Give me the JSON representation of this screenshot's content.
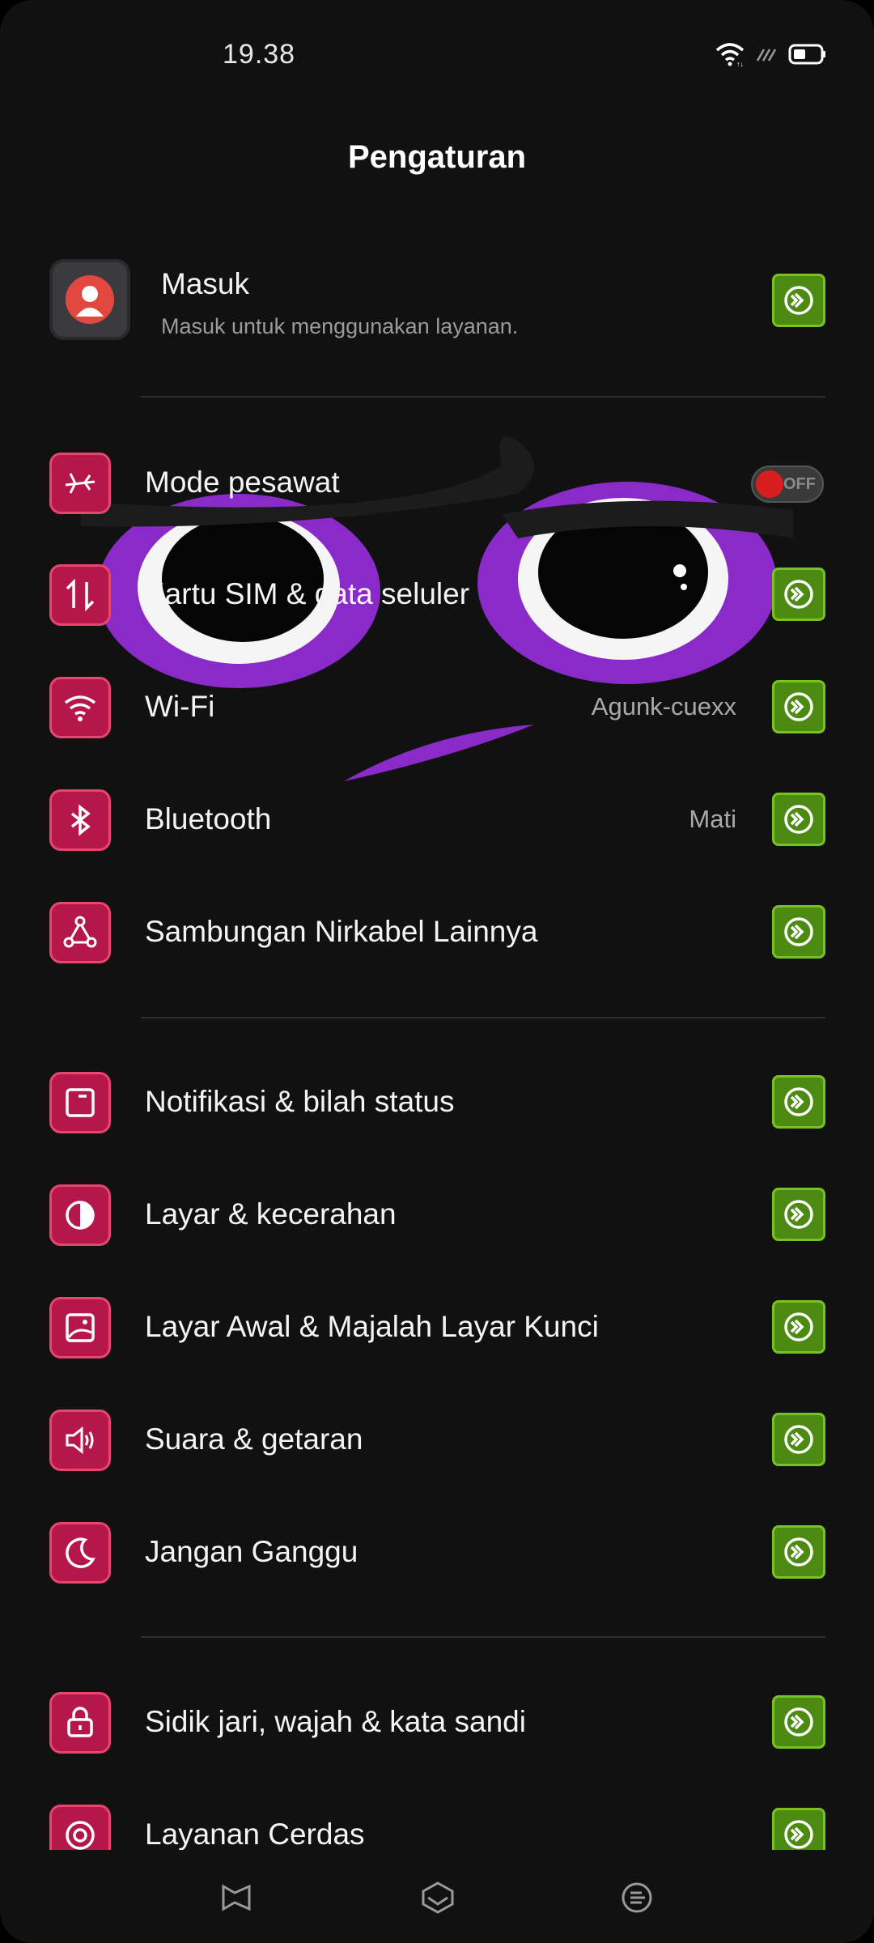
{
  "status_bar": {
    "time": "19.38"
  },
  "page_title": "Pengaturan",
  "account": {
    "title": "Masuk",
    "subtitle": "Masuk untuk menggunakan layanan."
  },
  "rows": {
    "airplane": {
      "label": "Mode pesawat",
      "toggle_text": "OFF"
    },
    "sim": {
      "label": "Kartu SIM & data seluler"
    },
    "wifi": {
      "label": "Wi-Fi",
      "value": "Agunk-cuexx"
    },
    "bluetooth": {
      "label": "Bluetooth",
      "value": "Mati"
    },
    "wireless": {
      "label": "Sambungan Nirkabel Lainnya"
    },
    "notifications": {
      "label": "Notifikasi & bilah status"
    },
    "display": {
      "label": "Layar & kecerahan"
    },
    "homescreen": {
      "label": "Layar Awal & Majalah Layar Kunci"
    },
    "sound": {
      "label": "Suara & getaran"
    },
    "dnd": {
      "label": "Jangan Ganggu"
    },
    "security": {
      "label": "Sidik jari, wajah & kata sandi"
    },
    "smart": {
      "label": "Layanan Cerdas"
    }
  },
  "icons": {
    "wifi_status": "wifi-icon",
    "signal_status": "signal-icon",
    "battery_status": "battery-icon",
    "go_button": "arrow-circle-icon",
    "nav_back": "back-icon",
    "nav_home": "home-icon",
    "nav_recents": "recents-icon"
  },
  "colors": {
    "background": "#111112",
    "icon_accent": "#b5174b",
    "go_accent": "#4c8a12",
    "toggle_knob": "#d81e1e"
  }
}
